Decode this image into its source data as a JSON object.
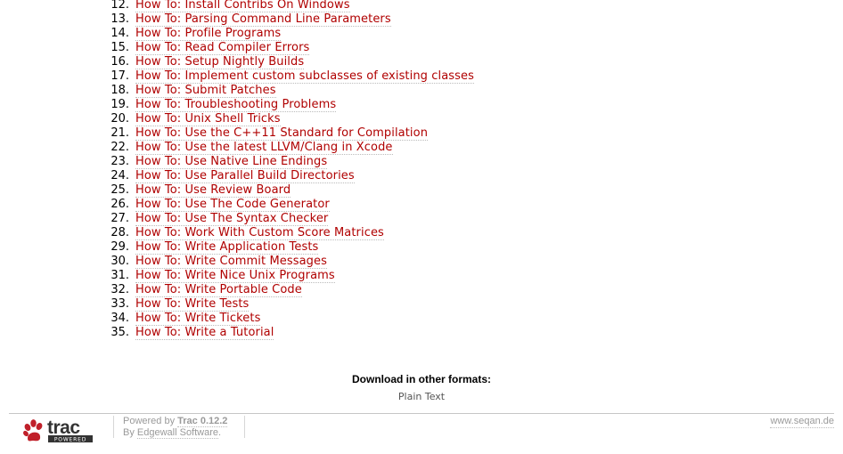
{
  "howto_items": [
    {
      "num": "12.",
      "label": "How To: Install Contribs On Windows"
    },
    {
      "num": "13.",
      "label": "How To: Parsing Command Line Parameters"
    },
    {
      "num": "14.",
      "label": "How To: Profile Programs"
    },
    {
      "num": "15.",
      "label": "How To: Read Compiler Errors"
    },
    {
      "num": "16.",
      "label": "How To: Setup Nightly Builds"
    },
    {
      "num": "17.",
      "label": "How To: Implement custom subclasses of existing classes"
    },
    {
      "num": "18.",
      "label": "How To: Submit Patches"
    },
    {
      "num": "19.",
      "label": "How To: Troubleshooting Problems"
    },
    {
      "num": "20.",
      "label": "How To: Unix Shell Tricks"
    },
    {
      "num": "21.",
      "label": "How To: Use the C++11 Standard for Compilation"
    },
    {
      "num": "22.",
      "label": "How To: Use the latest LLVM/Clang in Xcode"
    },
    {
      "num": "23.",
      "label": "How To: Use Native Line Endings"
    },
    {
      "num": "24.",
      "label": "How To: Use Parallel Build Directories"
    },
    {
      "num": "25.",
      "label": "How To: Use Review Board"
    },
    {
      "num": "26.",
      "label": "How To: Use The Code Generator"
    },
    {
      "num": "27.",
      "label": "How To: Use The Syntax Checker"
    },
    {
      "num": "28.",
      "label": "How To: Work With Custom Score Matrices"
    },
    {
      "num": "29.",
      "label": "How To: Write Application Tests"
    },
    {
      "num": "30.",
      "label": "How To: Write Commit Messages"
    },
    {
      "num": "31.",
      "label": "How To: Write Nice Unix Programs"
    },
    {
      "num": "32.",
      "label": "How To: Write Portable Code"
    },
    {
      "num": "33.",
      "label": "How To: Write Tests"
    },
    {
      "num": "34.",
      "label": "How To: Write Tickets"
    },
    {
      "num": "35.",
      "label": "How To: Write a Tutorial"
    }
  ],
  "downloads": {
    "heading": "Download in other formats:",
    "formats": [
      "Plain Text"
    ]
  },
  "footer": {
    "logo_text": "trac",
    "logo_subtext": "POWERED",
    "powered_by_prefix": "Powered by ",
    "trac_version": "Trac 0.12.2",
    "by_prefix": "By ",
    "vendor": "Edgewall Software",
    "vendor_suffix": ".",
    "site": "www.seqan.de"
  },
  "colors": {
    "link": "#b00000",
    "footer_text": "#9a9a9a",
    "logo_paw": "#c0202a"
  },
  "icons": {
    "logo": "trac-paw-logo"
  }
}
